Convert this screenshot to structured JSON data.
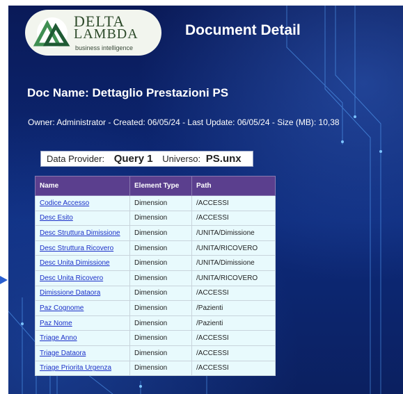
{
  "logo": {
    "line1": "DELTA",
    "line2": "LAMBDA",
    "tagline": "business intelligence"
  },
  "header": {
    "title": "Document Detail"
  },
  "doc": {
    "name": "Doc Name: Dettaglio Prestazioni PS",
    "meta": "Owner: Administrator - Created: 06/05/24 - Last Update: 06/05/24 - Size (MB): 10,38"
  },
  "provider": {
    "label": "Data Provider:",
    "query": "Query 1",
    "universe_label": "Universo:",
    "universe": "PS.unx"
  },
  "table": {
    "headers": [
      "Name",
      "Element Type",
      "Path"
    ],
    "rows": [
      [
        "Codice Accesso",
        "Dimension",
        "/ACCESSI"
      ],
      [
        "Desc Esito",
        "Dimension",
        "/ACCESSI"
      ],
      [
        "Desc Struttura Dimissione",
        "Dimension",
        "/UNITA/Dimissione"
      ],
      [
        "Desc Struttura Ricovero",
        "Dimension",
        "/UNITA/RICOVERO"
      ],
      [
        "Desc Unita Dimissione",
        "Dimension",
        "/UNITA/Dimissione"
      ],
      [
        "Desc Unita Ricovero",
        "Dimension",
        "/UNITA/RICOVERO"
      ],
      [
        "Dimissione Dataora",
        "Dimension",
        "/ACCESSI"
      ],
      [
        "Paz Cognome",
        "Dimension",
        "/Pazienti"
      ],
      [
        "Paz Nome",
        "Dimension",
        "/Pazienti"
      ],
      [
        "Triage Anno",
        "Dimension",
        "/ACCESSI"
      ],
      [
        "Triage Dataora",
        "Dimension",
        "/ACCESSI"
      ],
      [
        "Triage Priorita Urgenza",
        "Dimension",
        "/ACCESSI"
      ]
    ]
  },
  "colors": {
    "header_bg": "#5b3f8e",
    "row_bg": "#e8fafd",
    "link": "#1a2fc8",
    "panel_bg": "#0d2a7a"
  }
}
